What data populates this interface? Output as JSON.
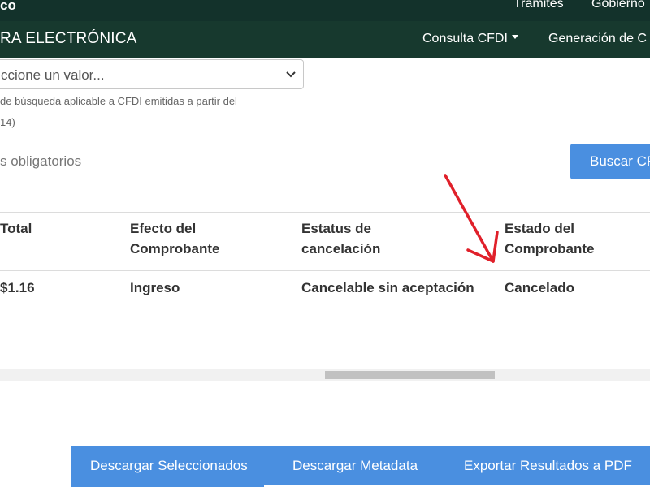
{
  "topbar": {
    "logo_fragment": "co",
    "links": [
      "Trámites",
      "Gobierno"
    ]
  },
  "appbar": {
    "brand": "RA ELECTRÓNICA",
    "menu": [
      "Consulta CFDI",
      "Generación de C"
    ]
  },
  "form": {
    "select_value": "ccione un valor...",
    "help_line1": "de búsqueda aplicable a CFDI emitidas a partir del",
    "help_line2": "14)",
    "required_note": "s obligatorios",
    "search_button": "Buscar CF"
  },
  "table": {
    "headers": [
      [
        "Total"
      ],
      [
        "Efecto del",
        "Comprobante"
      ],
      [
        "Estatus de",
        "cancelación"
      ],
      [
        "Estado del",
        "Comprobante"
      ]
    ],
    "rows": [
      [
        "$1.16",
        "Ingreso",
        "Cancelable sin aceptación",
        "Cancelado"
      ]
    ]
  },
  "actions": {
    "download_selected": "Descargar Seleccionados",
    "download_metadata": "Descargar Metadata",
    "export_pdf": "Exportar Resultados a PDF"
  },
  "colors": {
    "topbar": "#13322b",
    "appbar": "#17392e",
    "primary_button": "#4a8fe0",
    "annotation_arrow": "#e0202a"
  },
  "icons": {
    "select": "chevron-down-icon",
    "menu": "caret-down-icon",
    "annotation": "red-arrow"
  }
}
